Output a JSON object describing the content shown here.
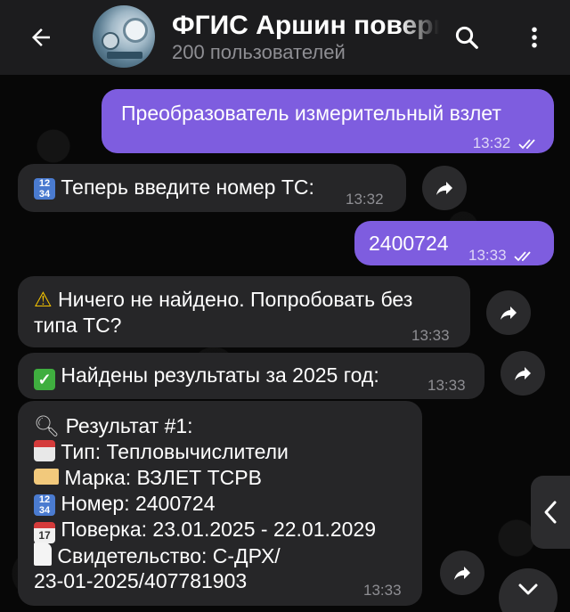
{
  "header": {
    "title": "ФГИС Аршин поверка",
    "subtitle": "200 пользователей"
  },
  "icons": {
    "back": "arrow-left-icon",
    "search": "search-icon",
    "menu": "more-vert-icon",
    "forward": "share-icon",
    "read": "double-check-icon"
  },
  "colors": {
    "outgoing_bubble": "#7e5ddf",
    "incoming_bubble": "#262628",
    "header_bg": "#1c1c1e"
  },
  "messages": [
    {
      "direction": "out",
      "text": "Преобразователь измерительный взлет",
      "time": "13:32"
    },
    {
      "direction": "in",
      "emoji": "🔢",
      "text": "Теперь введите номер ТС:",
      "time": "13:32"
    },
    {
      "direction": "out",
      "text": "2400724",
      "time": "13:33"
    },
    {
      "direction": "in",
      "emoji": "⚠️",
      "text_line1": "Ничего не найдено. Попробовать без",
      "text_line2": "типа ТС?",
      "time": "13:33"
    },
    {
      "direction": "in",
      "emoji": "✅",
      "text": "Найдены результаты за 2025 год:",
      "time": "13:33"
    },
    {
      "direction": "in",
      "lines": [
        {
          "emoji": "🔍",
          "text": "Результат #1:"
        },
        {
          "emoji": "📛",
          "text": "Тип: Тепловычислители"
        },
        {
          "emoji": "🏷️",
          "text": "Марка: ВЗЛЕТ ТСРВ"
        },
        {
          "emoji": "🔢",
          "text": "Номер: 2400724"
        },
        {
          "emoji": "📅",
          "text": "Поверка: 23.01.2025 - 22.01.2029"
        },
        {
          "emoji": "📄",
          "text": "Свидетельство: С-ДРХ/"
        },
        {
          "emoji": "",
          "text": "23-01-2025/407781903"
        }
      ],
      "time": "13:33"
    }
  ]
}
